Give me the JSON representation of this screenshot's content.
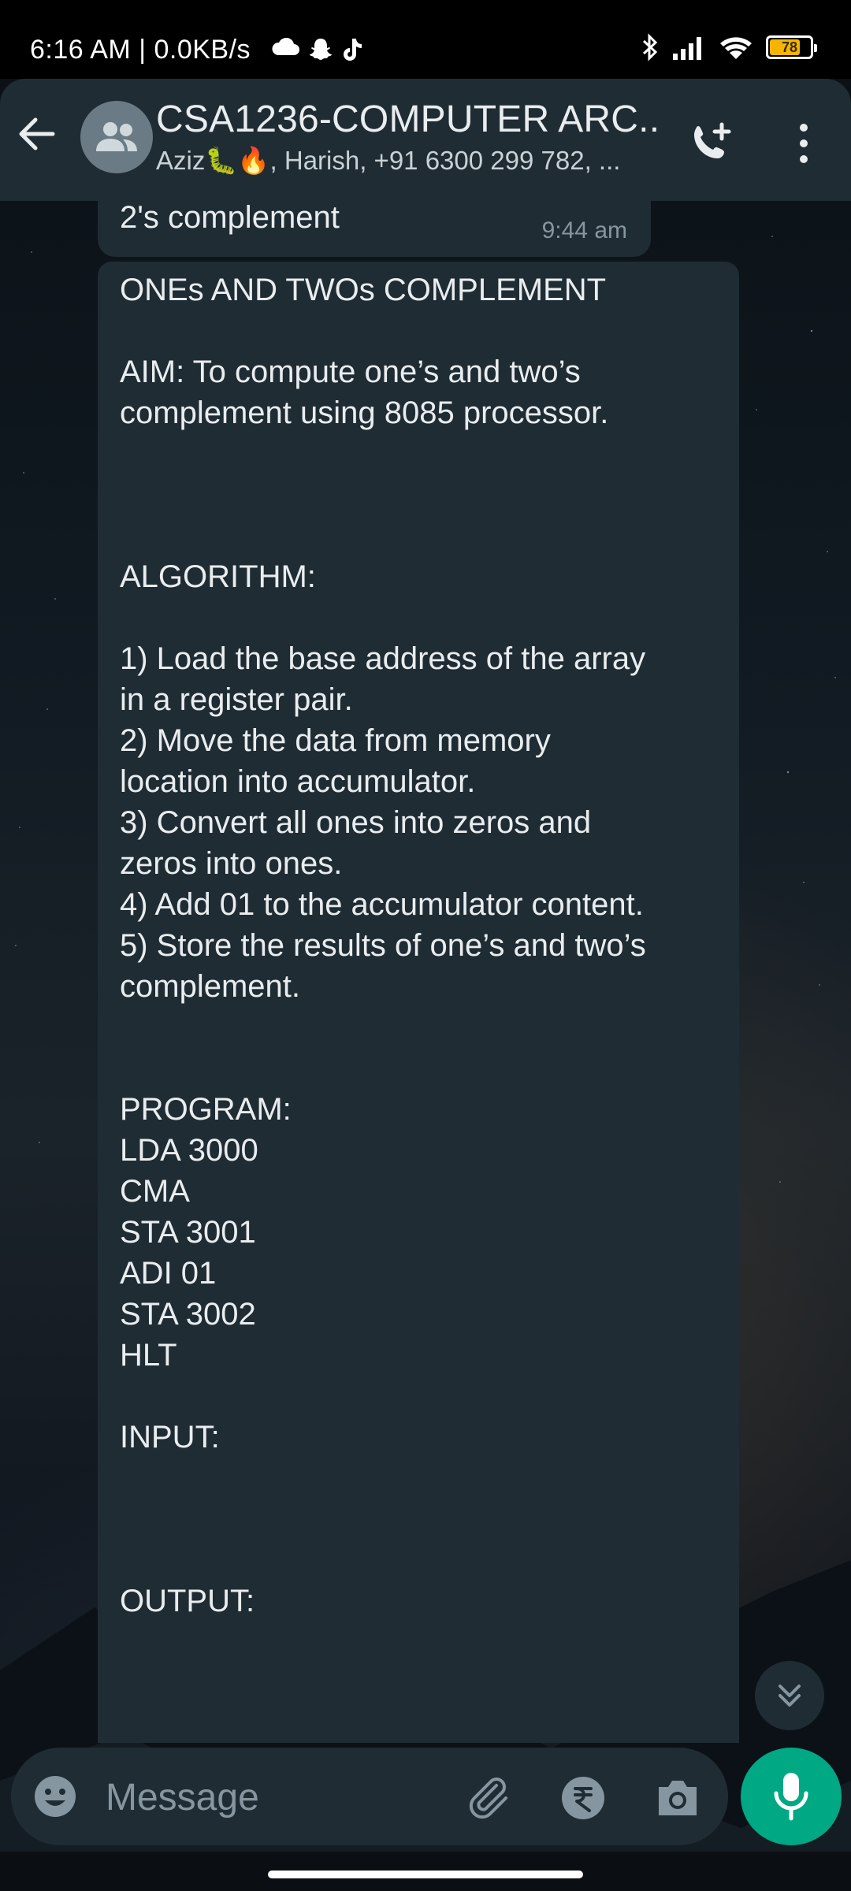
{
  "colors": {
    "header_bg": "#1f2c34",
    "bubble_bg": "#1f2c34",
    "accent_green": "#00a884",
    "text_primary": "#e9edef",
    "text_secondary": "#8696a0",
    "battery_fill": "#f5b400"
  },
  "status_bar": {
    "time": "6:16 AM | 0.0KB/s",
    "notification_icons": [
      "cloud-icon",
      "snapchat-icon",
      "tiktok-icon"
    ],
    "right_icons": [
      "bluetooth-icon",
      "signal-icon",
      "wifi-icon"
    ],
    "battery_level": "78"
  },
  "header": {
    "title": "CSA1236-COMPUTER ARC...",
    "members": "Aziz🐛🔥, Harish, +91 6300 299 782, ...",
    "icons": {
      "back": "back-arrow-icon",
      "avatar": "group-avatar-icon",
      "call": "add-call-icon",
      "menu": "more-vert-icon"
    }
  },
  "messages": {
    "previous": {
      "text": "2's complement",
      "time": "9:44 am"
    },
    "main_lines": [
      "ONEs AND TWOs COMPLEMENT",
      "",
      "AIM: To compute one’s and two’s",
      "complement using 8085 processor.",
      "",
      "",
      "",
      "ALGORITHM:",
      "",
      "1)  Load the base address of the array",
      "in a register pair.",
      "2)  Move the data from memory",
      "location into accumulator.",
      "3)  Convert all ones into zeros and",
      "zeros into ones.",
      "4)  Add 01 to the accumulator content.",
      "5)  Store the results of one’s and two’s",
      "complement.",
      "",
      "",
      "PROGRAM:",
      "LDA 3000",
      "CMA",
      "STA 3001",
      "ADI 01",
      "STA 3002",
      "HLT",
      "",
      "INPUT:",
      "",
      "",
      "",
      "OUTPUT:"
    ]
  },
  "input_bar": {
    "placeholder": "Message",
    "icons": [
      "emoji-icon",
      "attach-icon",
      "rupee-payment-icon",
      "camera-icon"
    ],
    "mic_icon": "microphone-icon",
    "scroll_icon": "double-chevron-down-icon"
  }
}
